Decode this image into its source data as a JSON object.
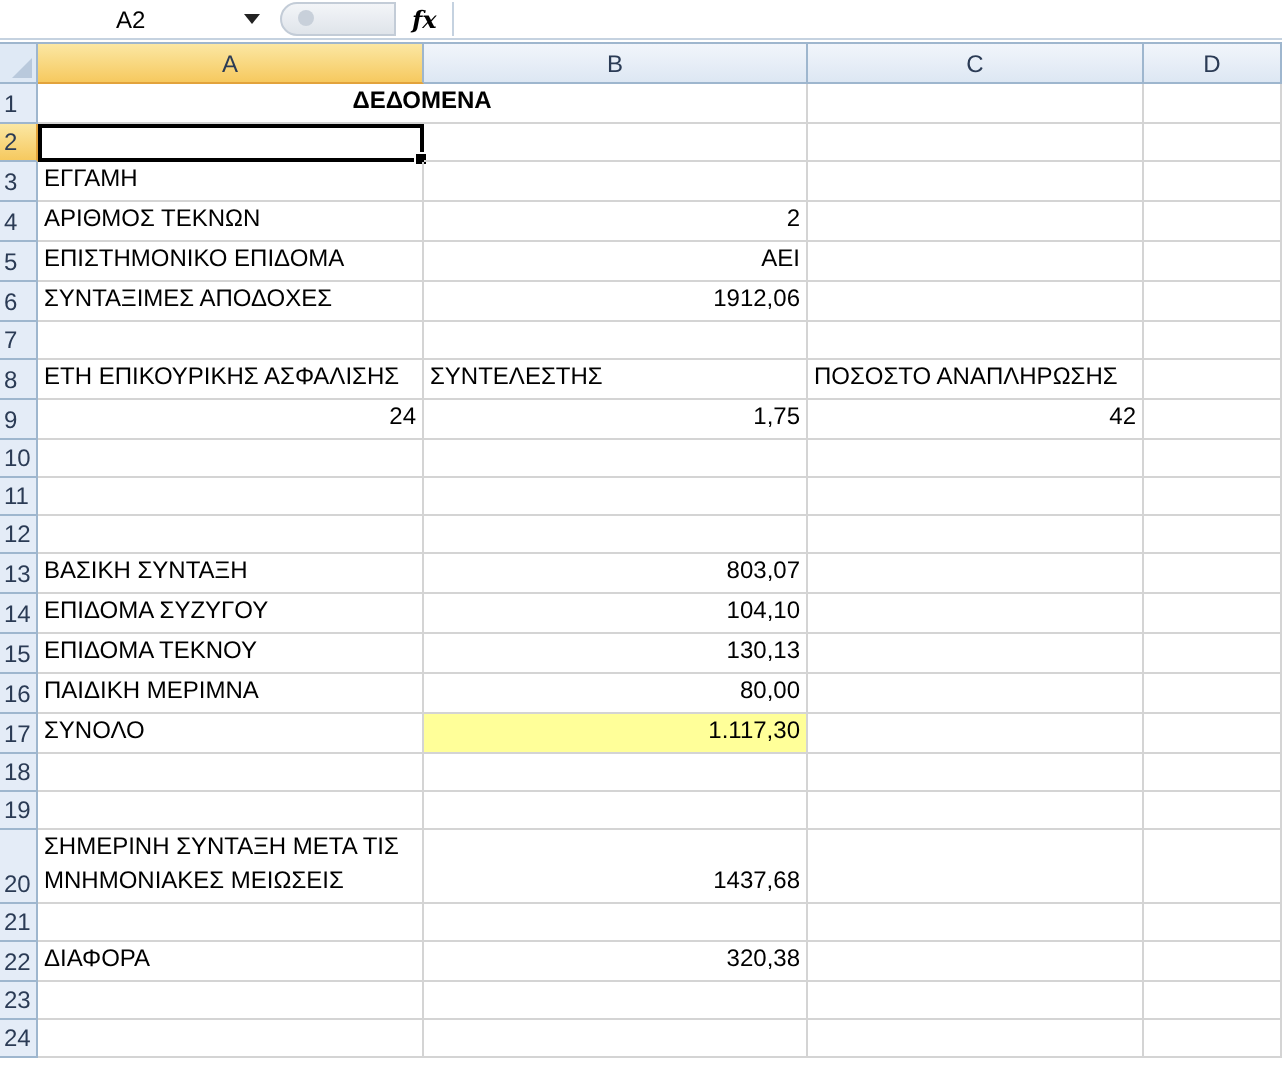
{
  "formula_bar": {
    "name_box": "A2",
    "function_label": "fx"
  },
  "columns": [
    {
      "label": "A",
      "selected": true
    },
    {
      "label": "B",
      "selected": false
    },
    {
      "label": "C",
      "selected": false
    },
    {
      "label": "D",
      "selected": false
    }
  ],
  "rows": [
    {
      "number": "1",
      "selected": false,
      "cells": [
        {
          "kind": "title",
          "text": "ΔΕΔΟΜΕΝΑ"
        },
        {
          "kind": "empty"
        },
        {
          "kind": "empty"
        }
      ]
    },
    {
      "number": "2",
      "selected": true,
      "cells": [
        {
          "kind": "empty",
          "selected": true
        },
        {
          "kind": "empty"
        },
        {
          "kind": "empty"
        },
        {
          "kind": "empty"
        }
      ]
    },
    {
      "number": "3",
      "selected": false,
      "cells": [
        {
          "kind": "text",
          "text": "ΕΓΓΑΜΗ"
        },
        {
          "kind": "empty"
        },
        {
          "kind": "empty"
        },
        {
          "kind": "empty"
        }
      ]
    },
    {
      "number": "4",
      "selected": false,
      "cells": [
        {
          "kind": "text",
          "text": "ΑΡΙΘΜΟΣ ΤΕΚΝΩΝ"
        },
        {
          "kind": "number",
          "text": "2"
        },
        {
          "kind": "empty"
        },
        {
          "kind": "empty"
        }
      ]
    },
    {
      "number": "5",
      "selected": false,
      "cells": [
        {
          "kind": "text",
          "text": "ΕΠΙΣΤΗΜΟΝΙΚΟ ΕΠΙΔΟΜΑ"
        },
        {
          "kind": "number",
          "text": "ΑΕΙ"
        },
        {
          "kind": "empty"
        },
        {
          "kind": "empty"
        }
      ]
    },
    {
      "number": "6",
      "selected": false,
      "cells": [
        {
          "kind": "text",
          "text": "ΣΥΝΤΑΞΙΜΕΣ ΑΠΟΔΟΧΕΣ"
        },
        {
          "kind": "number",
          "text": "1912,06"
        },
        {
          "kind": "empty"
        },
        {
          "kind": "empty"
        }
      ]
    },
    {
      "number": "7",
      "selected": false,
      "cells": [
        {
          "kind": "empty"
        },
        {
          "kind": "empty"
        },
        {
          "kind": "empty"
        },
        {
          "kind": "empty"
        }
      ]
    },
    {
      "number": "8",
      "selected": false,
      "cells": [
        {
          "kind": "text",
          "text": "ΕΤΗ ΕΠΙΚΟΥΡΙΚΗΣ ΑΣΦΑΛΙΣΗΣ"
        },
        {
          "kind": "text",
          "text": "ΣΥΝΤΕΛΕΣΤΗΣ"
        },
        {
          "kind": "text",
          "text": "ΠΟΣΟΣΤΟ ΑΝΑΠΛΗΡΩΣΗΣ"
        },
        {
          "kind": "empty"
        }
      ]
    },
    {
      "number": "9",
      "selected": false,
      "cells": [
        {
          "kind": "number",
          "text": "24"
        },
        {
          "kind": "number",
          "text": "1,75"
        },
        {
          "kind": "number",
          "text": "42"
        },
        {
          "kind": "empty"
        }
      ]
    },
    {
      "number": "10",
      "selected": false,
      "cells": [
        {
          "kind": "empty"
        },
        {
          "kind": "empty"
        },
        {
          "kind": "empty"
        },
        {
          "kind": "empty"
        }
      ]
    },
    {
      "number": "11",
      "selected": false,
      "cells": [
        {
          "kind": "empty"
        },
        {
          "kind": "empty"
        },
        {
          "kind": "empty"
        },
        {
          "kind": "empty"
        }
      ]
    },
    {
      "number": "12",
      "selected": false,
      "cells": [
        {
          "kind": "empty"
        },
        {
          "kind": "empty"
        },
        {
          "kind": "empty"
        },
        {
          "kind": "empty"
        }
      ]
    },
    {
      "number": "13",
      "selected": false,
      "cells": [
        {
          "kind": "text",
          "text": "ΒΑΣΙΚΗ ΣΥΝΤΑΞΗ"
        },
        {
          "kind": "number",
          "text": "803,07"
        },
        {
          "kind": "empty"
        },
        {
          "kind": "empty"
        }
      ]
    },
    {
      "number": "14",
      "selected": false,
      "cells": [
        {
          "kind": "text",
          "text": "ΕΠΙΔΟΜΑ ΣΥΖΥΓΟΥ"
        },
        {
          "kind": "number",
          "text": "104,10"
        },
        {
          "kind": "empty"
        },
        {
          "kind": "empty"
        }
      ]
    },
    {
      "number": "15",
      "selected": false,
      "cells": [
        {
          "kind": "text",
          "text": "ΕΠΙΔΟΜΑ ΤΕΚΝΟΥ"
        },
        {
          "kind": "number",
          "text": "130,13"
        },
        {
          "kind": "empty"
        },
        {
          "kind": "empty"
        }
      ]
    },
    {
      "number": "16",
      "selected": false,
      "cells": [
        {
          "kind": "text",
          "text": "ΠΑΙΔΙΚΗ ΜΕΡΙΜΝΑ"
        },
        {
          "kind": "number",
          "text": "80,00"
        },
        {
          "kind": "empty"
        },
        {
          "kind": "empty"
        }
      ]
    },
    {
      "number": "17",
      "selected": false,
      "cells": [
        {
          "kind": "text",
          "text": "ΣΥΝΟΛΟ"
        },
        {
          "kind": "number",
          "text": "1.117,30",
          "highlighted": true
        },
        {
          "kind": "empty"
        },
        {
          "kind": "empty"
        }
      ]
    },
    {
      "number": "18",
      "selected": false,
      "cells": [
        {
          "kind": "empty"
        },
        {
          "kind": "empty"
        },
        {
          "kind": "empty"
        },
        {
          "kind": "empty"
        }
      ]
    },
    {
      "number": "19",
      "selected": false,
      "cells": [
        {
          "kind": "empty"
        },
        {
          "kind": "empty"
        },
        {
          "kind": "empty"
        },
        {
          "kind": "empty"
        }
      ]
    },
    {
      "number": "20",
      "selected": false,
      "cells": [
        {
          "kind": "text",
          "text": "ΣΗΜΕΡΙΝΗ ΣΥΝΤΑΞΗ ΜΕΤΑ ΤΙΣ ΜΝΗΜΟΝΙΑΚΕΣ ΜΕΙΩΣΕΙΣ"
        },
        {
          "kind": "number",
          "text": "1437,68"
        },
        {
          "kind": "empty"
        },
        {
          "kind": "empty"
        }
      ]
    },
    {
      "number": "21",
      "selected": false,
      "cells": [
        {
          "kind": "empty"
        },
        {
          "kind": "empty"
        },
        {
          "kind": "empty"
        },
        {
          "kind": "empty"
        }
      ]
    },
    {
      "number": "22",
      "selected": false,
      "cells": [
        {
          "kind": "text",
          "text": "ΔΙΑΦΟΡΑ"
        },
        {
          "kind": "number",
          "text": "320,38"
        },
        {
          "kind": "empty"
        },
        {
          "kind": "empty"
        }
      ]
    },
    {
      "number": "23",
      "selected": false,
      "cells": [
        {
          "kind": "empty"
        },
        {
          "kind": "empty"
        },
        {
          "kind": "empty"
        },
        {
          "kind": "empty"
        }
      ]
    },
    {
      "number": "24",
      "selected": false,
      "cells": [
        {
          "kind": "empty"
        },
        {
          "kind": "empty"
        },
        {
          "kind": "empty"
        },
        {
          "kind": "empty"
        }
      ]
    }
  ]
}
